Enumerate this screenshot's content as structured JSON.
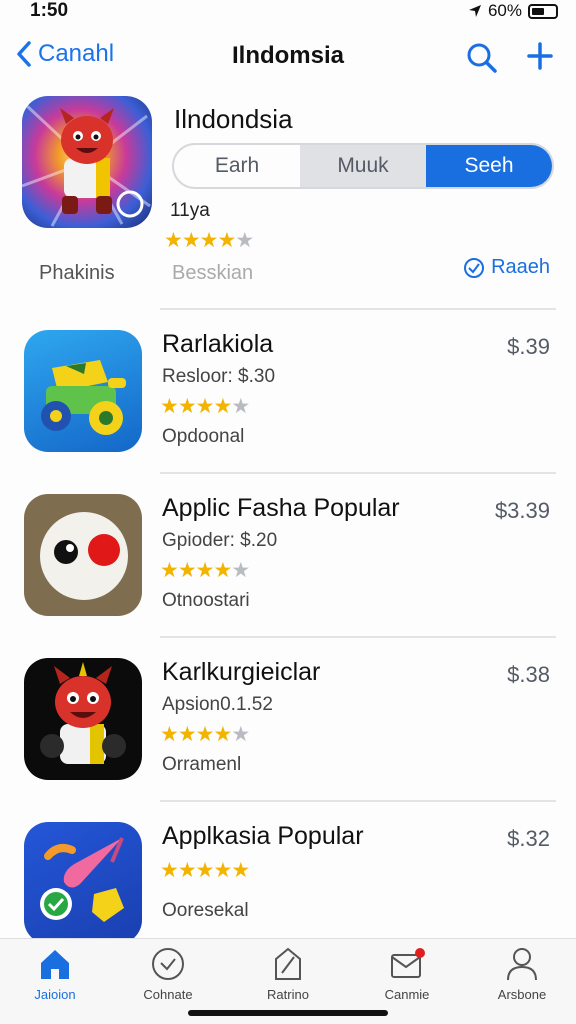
{
  "status": {
    "time": "1:50",
    "battery_text": "60%"
  },
  "nav": {
    "back_label": "Canahl",
    "title": "Ilndomsia"
  },
  "featured": {
    "name": "Ilndondsia",
    "segments": [
      "Earh",
      "Muuk",
      "Seeh"
    ],
    "active_segment": 2,
    "meta": "11ya",
    "rating": 4,
    "left_label": "Phakinis",
    "mid_label": "Besskian",
    "link_label": "Raaeh"
  },
  "apps": [
    {
      "name": "Rarlakiola",
      "sub": "Resloor: $.30",
      "tag": "Opdoonal",
      "price": "$.39",
      "rating": 4,
      "icon": "toy-car-icon"
    },
    {
      "name": "Applic Fasha Popular",
      "sub": "Gpioder: $.20",
      "tag": "Otnoostari",
      "price": "$3.39",
      "rating": 4,
      "icon": "eyeball-icon"
    },
    {
      "name": "Karlkurgieiclar",
      "sub": "Apsion0.1.52",
      "tag": "Orramenl",
      "price": "$.38",
      "rating": 3.5,
      "icon": "red-monster-icon"
    },
    {
      "name": "Applkasia Popular",
      "sub": "",
      "tag": "Ooresekal",
      "price": "$.32",
      "rating": 5,
      "icon": "paint-brush-icon"
    }
  ],
  "tabs": [
    {
      "label": "Jaioion",
      "icon": "home-icon",
      "active": true
    },
    {
      "label": "Cohnate",
      "icon": "check-circle-icon",
      "active": false
    },
    {
      "label": "Ratrino",
      "icon": "tag-icon",
      "active": false
    },
    {
      "label": "Canmie",
      "icon": "mail-badge-icon",
      "active": false
    },
    {
      "label": "Arsbone",
      "icon": "person-icon",
      "active": false
    }
  ],
  "colors": {
    "accent": "#1a6fe0",
    "star": "#f2b400"
  }
}
